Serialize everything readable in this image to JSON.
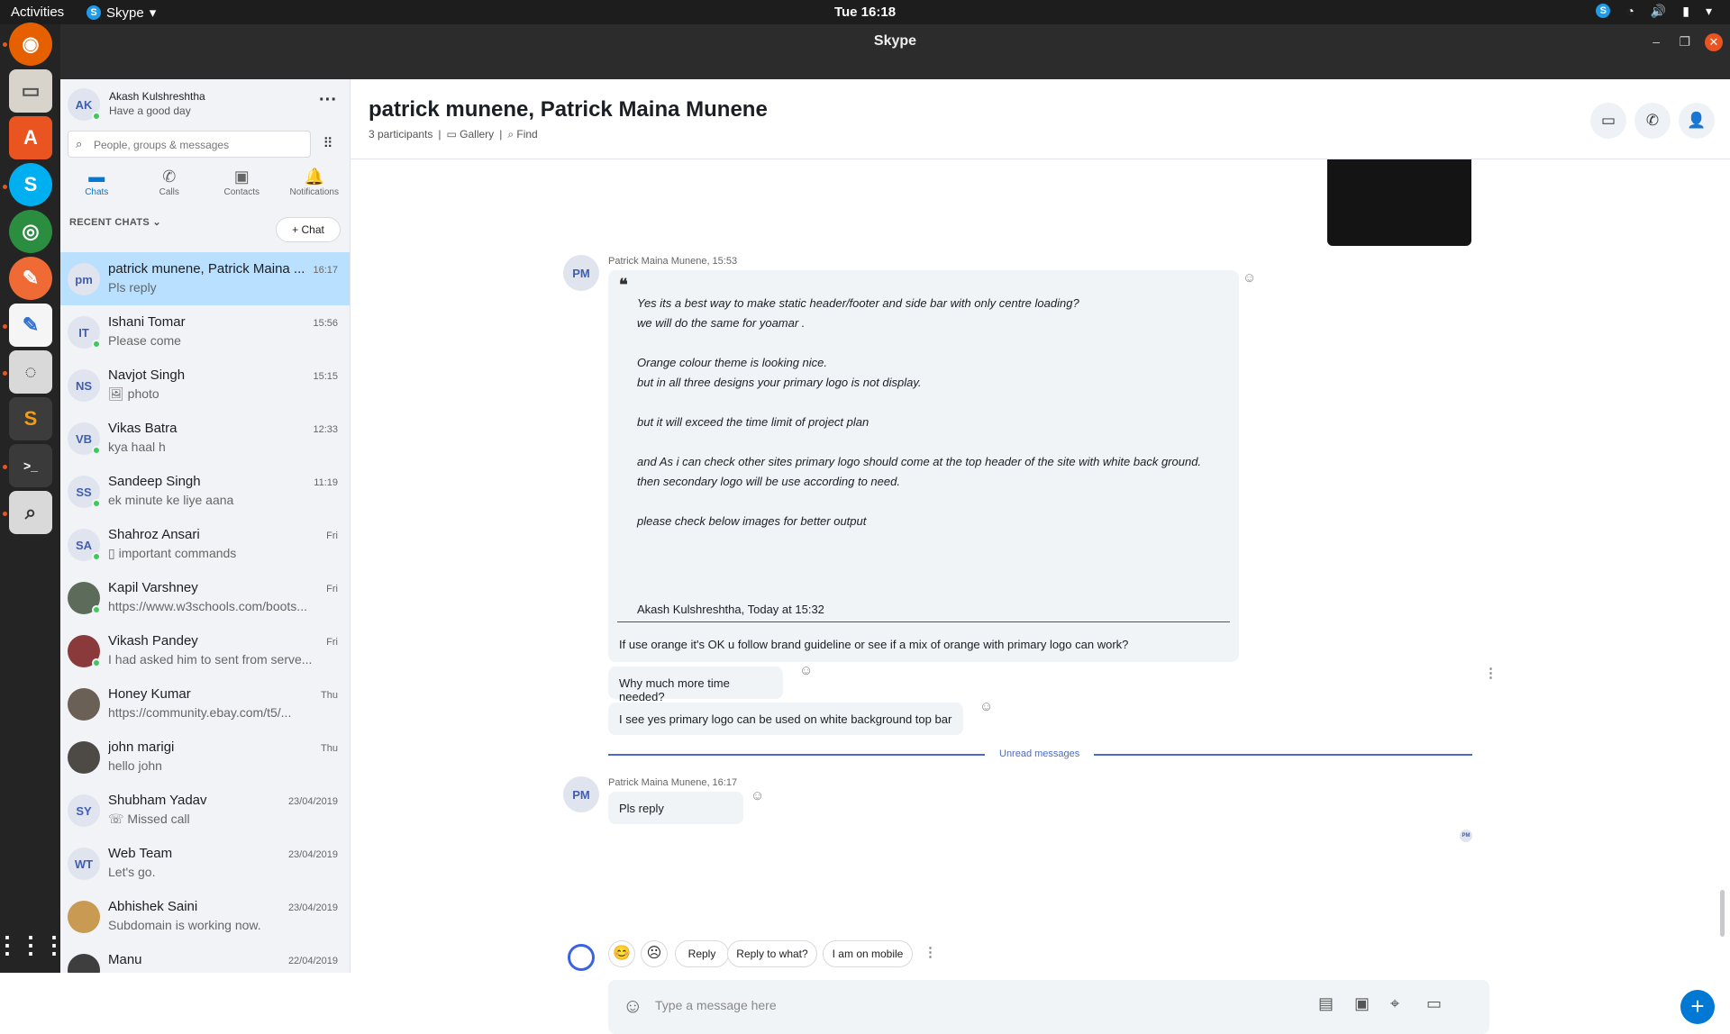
{
  "topbar": {
    "activities": "Activities",
    "app_name": "Skype",
    "clock": "Tue 16:18"
  },
  "window": {
    "title": "Skype"
  },
  "profile": {
    "initials": "AK",
    "name": "Akash Kulshreshtha",
    "mood": "Have a good day"
  },
  "search": {
    "placeholder": "People, groups & messages"
  },
  "nav": {
    "chats": "Chats",
    "calls": "Calls",
    "contacts": "Contacts",
    "notifications": "Notifications"
  },
  "recent": {
    "header": "RECENT CHATS",
    "new_chat": "Chat"
  },
  "chats": [
    {
      "initials": "pm",
      "name": "patrick munene, Patrick Maina ...",
      "preview": "Pls reply",
      "time": "16:17"
    },
    {
      "initials": "IT",
      "name": "Ishani Tomar",
      "preview": "Please come",
      "time": "15:56"
    },
    {
      "initials": "NS",
      "name": "Navjot Singh",
      "preview": "photo",
      "time": "15:15"
    },
    {
      "initials": "VB",
      "name": "Vikas Batra",
      "preview": "kya haal h",
      "time": "12:33"
    },
    {
      "initials": "SS",
      "name": "Sandeep Singh",
      "preview": "ek minute ke liye aana",
      "time": "11:19"
    },
    {
      "initials": "SA",
      "name": "Shahroz Ansari",
      "preview": "important commands",
      "time": "Fri"
    },
    {
      "initials": "",
      "name": "Kapil Varshney",
      "preview": "https://www.w3schools.com/boots...",
      "time": "Fri"
    },
    {
      "initials": "",
      "name": "Vikash Pandey",
      "preview": "I had asked him to sent from serve...",
      "time": "Fri"
    },
    {
      "initials": "",
      "name": "Honey Kumar",
      "preview": "https://community.ebay.com/t5/...",
      "time": "Thu"
    },
    {
      "initials": "",
      "name": "john marigi",
      "preview": "hello john",
      "time": "Thu"
    },
    {
      "initials": "SY",
      "name": "Shubham Yadav",
      "preview": "Missed call",
      "time": "23/04/2019"
    },
    {
      "initials": "WT",
      "name": "Web Team",
      "preview": "Let's go.",
      "time": "23/04/2019"
    },
    {
      "initials": "",
      "name": "Abhishek  Saini",
      "preview": "Subdomain is working now.",
      "time": "23/04/2019"
    },
    {
      "initials": "",
      "name": "Manu",
      "preview": "",
      "time": "22/04/2019"
    }
  ],
  "conversation": {
    "title": "patrick munene, Patrick Maina Munene",
    "participants": "3 participants",
    "gallery": "Gallery",
    "find": "Find"
  },
  "messages": {
    "m1_sender": "Patrick Maina Munene, 15:53",
    "m1_initials": "PM",
    "quote_lines": [
      "Yes its a best way to make static  header/footer and side bar with only centre loading?",
      "we will do the same for yoamar .",
      "Orange colour theme is looking nice.",
      "but in all three designs your primary logo is not display.",
      "but it will exceed the time limit of project plan",
      "and As i can check other sites primary logo  should come at the top header of the site with white back ground.",
      "then secondary logo will be use according to need.",
      "please check below images for better output"
    ],
    "quote_author": "Akash Kulshreshtha, Today at 15:32",
    "reply_text": "If use orange it's OK u follow brand guideline or see if a mix of orange with primary logo can work?",
    "msg2": "Why much more time needed?",
    "msg3": "I see yes primary logo can be used on white background top bar",
    "unread": "Unread messages",
    "m4_sender": "Patrick Maina Munene, 16:17",
    "m4_initials": "PM",
    "msg4": "Pls reply",
    "read_receipt": "PM"
  },
  "suggestions": {
    "reply": "Reply",
    "reply_what": "Reply to what?",
    "mobile": "I am on mobile"
  },
  "composer": {
    "placeholder": "Type a message here"
  },
  "colors": {
    "accent": "#0078d4",
    "active_chat": "#b9e1ff",
    "online": "#3fc95a"
  }
}
